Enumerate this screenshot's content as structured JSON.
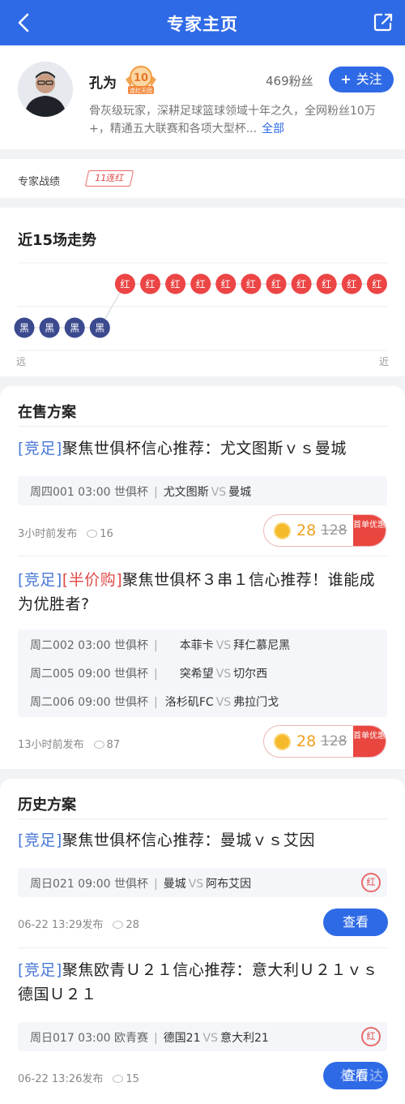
{
  "header": {
    "title": "专家主页"
  },
  "profile": {
    "name": "孔为",
    "medal_number": "10",
    "medal_caption": "连红天团",
    "fans": "469粉丝",
    "follow_label": "关注",
    "bio": "骨灰级玩家，深耕足球篮球领域十年之久，全网粉丝10万+，精通五大联赛和各项大型杯...",
    "bio_more": "全部"
  },
  "record": {
    "label": "专家战绩",
    "streak": "11连红"
  },
  "trend": {
    "title": "近15场走势",
    "far_label": "远",
    "near_label": "近",
    "results": [
      "黑",
      "黑",
      "黑",
      "黑",
      "红",
      "红",
      "红",
      "红",
      "红",
      "红",
      "红",
      "红",
      "红",
      "红",
      "红"
    ],
    "colors": {
      "red": "#ec4545",
      "black": "#3b4a8e"
    }
  },
  "on_sale": {
    "title": "在售方案",
    "plans": [
      {
        "tags": [
          "[竞足]"
        ],
        "title": "聚焦世俱杯信心推荐：尤文图斯ｖｓ曼城",
        "matches": [
          {
            "info": "周四001 03:00 世俱杯",
            "home": "尤文图斯",
            "vs": "VS",
            "away": "曼城"
          }
        ],
        "published": "3小时前发布",
        "views": "16",
        "price": "28",
        "original_price": "128",
        "promo": "首单优惠"
      },
      {
        "tags": [
          "[竞足]",
          "[半价购]"
        ],
        "title": "聚焦世俱杯３串１信心推荐！谁能成为优胜者?",
        "matches": [
          {
            "info": "周二002 03:00 世俱杯",
            "home": "本菲卡",
            "vs": "VS",
            "away": "拜仁慕尼黑"
          },
          {
            "info": "周二005 09:00 世俱杯",
            "home": "突希望",
            "vs": "VS",
            "away": "切尔西"
          },
          {
            "info": "周二006 09:00 世俱杯",
            "home": "洛杉矶FC",
            "vs": "VS",
            "away": "弗拉门戈"
          }
        ],
        "published": "13小时前发布",
        "views": "87",
        "price": "28",
        "original_price": "128",
        "promo": "首单优惠"
      }
    ]
  },
  "history": {
    "title": "历史方案",
    "plans": [
      {
        "tag": "[竞足]",
        "title": "聚焦世俱杯信心推荐：曼城ｖｓ艾因",
        "match": {
          "info": "周日021 09:00 世俱杯",
          "home": "曼城",
          "vs": "VS",
          "away": "阿布艾因"
        },
        "result_seal": "红",
        "published": "06-22 13:29发布",
        "views": "28",
        "view_label": "查看"
      },
      {
        "tag": "[竞足]",
        "title": "聚焦欧青Ｕ２１信心推荐：意大利Ｕ２１ｖｓ德国Ｕ２１",
        "match": {
          "info": "周日017 03:00 欧青赛",
          "home": "德国21",
          "vs": "VS",
          "away": "意大利21"
        },
        "result_seal": "红",
        "published": "06-22 13:26发布",
        "views": "15",
        "view_label": "查看"
      }
    ]
  },
  "watermark": "松辰达"
}
